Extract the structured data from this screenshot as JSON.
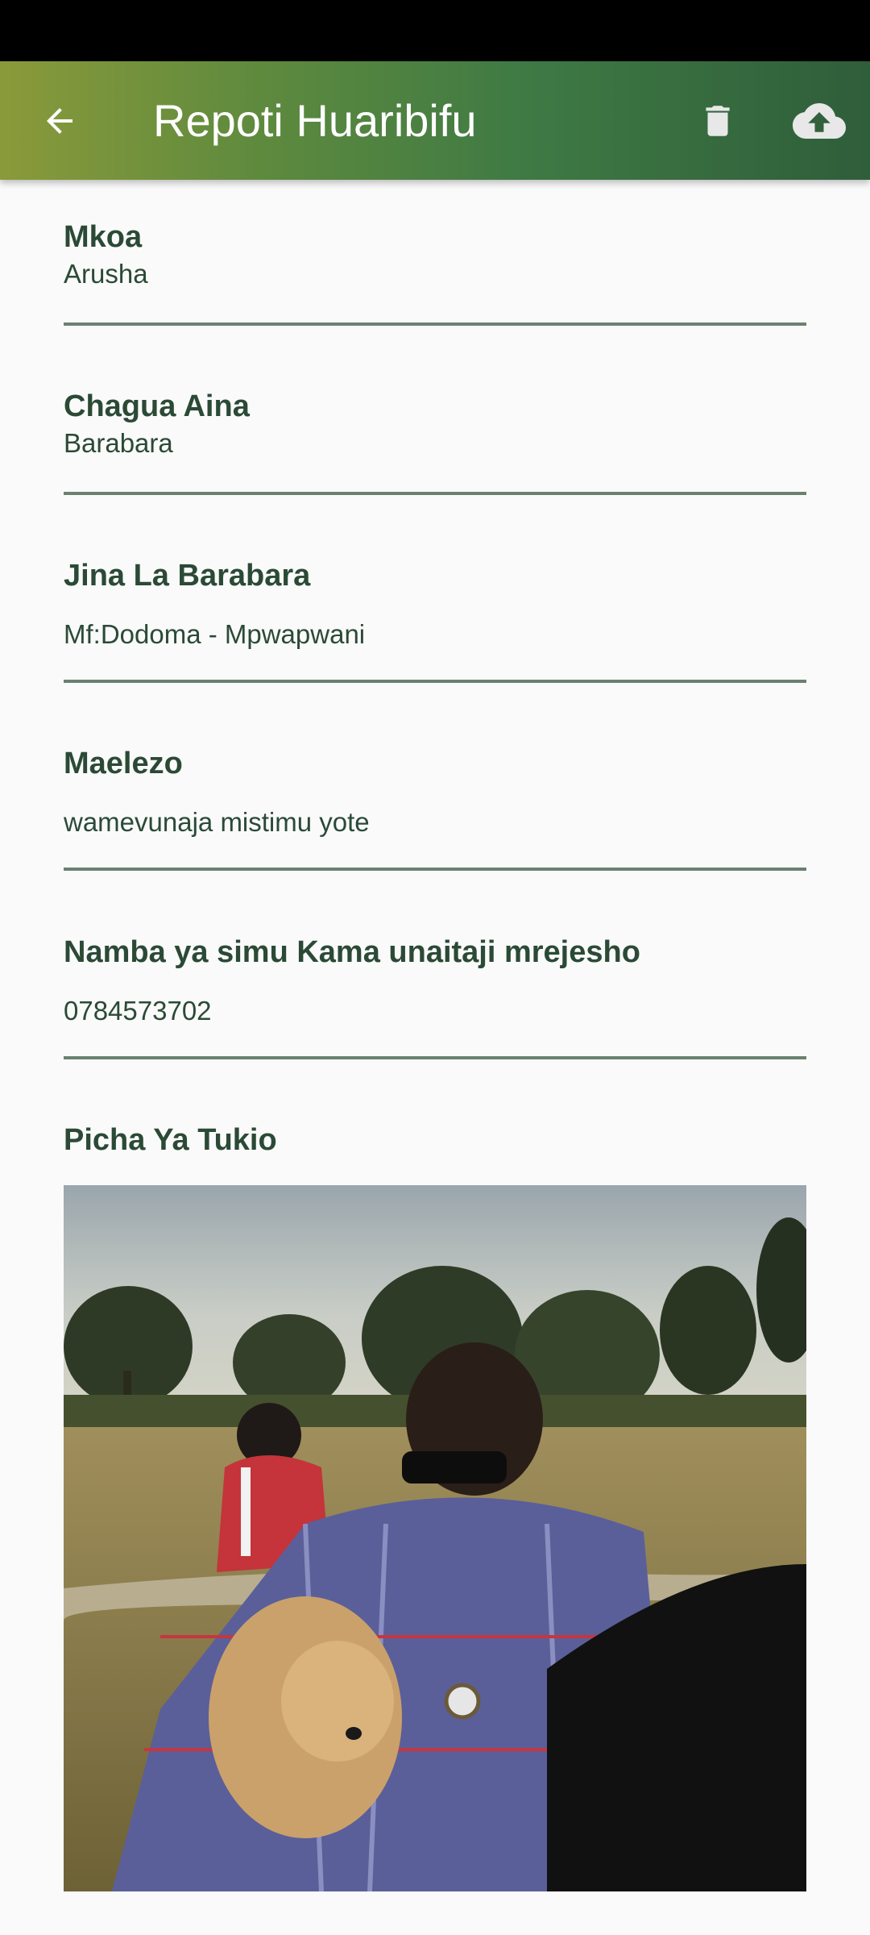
{
  "header": {
    "title": "Repoti Huaribifu",
    "back_icon": "arrow-back-icon",
    "delete_icon": "trash-icon",
    "upload_icon": "cloud-upload-icon"
  },
  "form": {
    "region": {
      "label": "Mkoa",
      "value": "Arusha"
    },
    "type": {
      "label": "Chagua Aina",
      "value": "Barabara"
    },
    "road_name": {
      "label": "Jina La Barabara",
      "value": "Mf:Dodoma - Mpwapwani"
    },
    "description": {
      "label": "Maelezo",
      "value": "wamevunaja mistimu yote"
    },
    "phone": {
      "label": "Namba ya simu Kama unaitaji mrejesho",
      "value": "0784573702"
    },
    "photo": {
      "label": "Picha Ya Tukio"
    }
  },
  "colors": {
    "primary": "#3f7a44",
    "text": "#2b4a36",
    "underline": "#6a8170"
  }
}
